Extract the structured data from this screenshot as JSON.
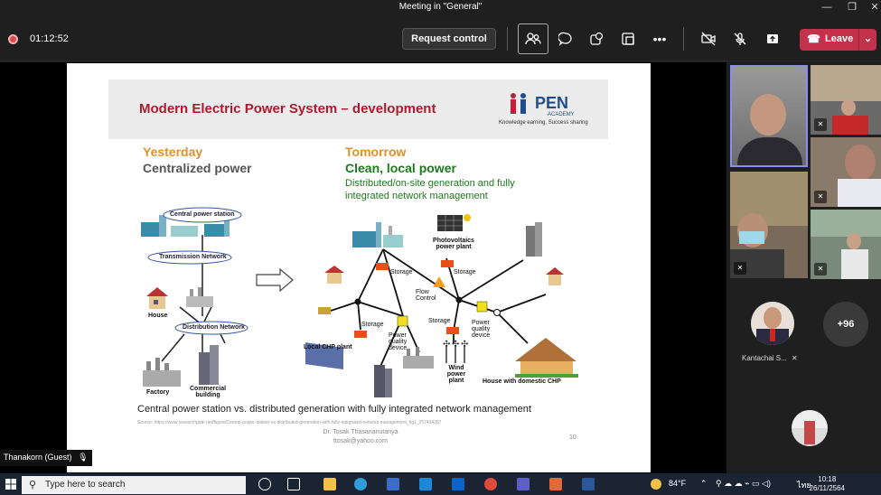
{
  "window": {
    "title": "Meeting in \"General\"",
    "controls": [
      "minimize",
      "maximize",
      "close"
    ]
  },
  "toolbar": {
    "timer": "01:12:52",
    "request_control": "Request control",
    "leave": "Leave",
    "icons": [
      "people-icon",
      "chat-icon",
      "reactions-icon",
      "share-tray-icon",
      "more-icon",
      "camera-off-icon",
      "mic-off-icon",
      "share-icon"
    ]
  },
  "slide": {
    "title": "Modern Electric Power System – development",
    "logo": {
      "name": "PEN",
      "sub": "ACADEMY",
      "tagline": "Knowledge earning, Success sharing"
    },
    "yesterday": {
      "heading": "Yesterday",
      "subheading": "Centralized power"
    },
    "tomorrow": {
      "heading": "Tomorrow",
      "subheading": "Clean, local power",
      "description": "Distributed/on-site generation and fully integrated network management"
    },
    "left_labels": {
      "central": "Central power station",
      "transmission": "Transmission Network",
      "house": "House",
      "distribution": "Distribution Network",
      "factory": "Factory",
      "commercial": "Commercial building"
    },
    "right_labels": {
      "pv": "Photovoltaics power plant",
      "storage1": "Storage",
      "storage2": "Storage",
      "storage3": "Storage",
      "storage4": "Storage",
      "flow": "Flow Control",
      "pq1": "Power quality device",
      "pq2": "Power quality device",
      "chp": "Local CHP plant",
      "wind": "Wind power plant",
      "house_chp": "House with domestic CHP"
    },
    "caption": "Central power station vs. distributed generation with fully integrated network management",
    "source": "Source: https://www.researchgate.net/figure/Central-power-station-vs-distributed-generation-with-fully-integrated-network-management_fig1_257434287",
    "author": "Dr. Tosak Thasananutariya",
    "email": "ttosak@yahoo.com",
    "page": "10"
  },
  "presenter_badge": "Thanakorn (Guest)",
  "gallery": {
    "named_participant": "Kantachai S...",
    "more_count": "+96"
  },
  "taskbar": {
    "search_placeholder": "Type here to search",
    "weather": "84°F",
    "lang": "ไทย",
    "time": "10:18",
    "date": "26/11/2564"
  }
}
